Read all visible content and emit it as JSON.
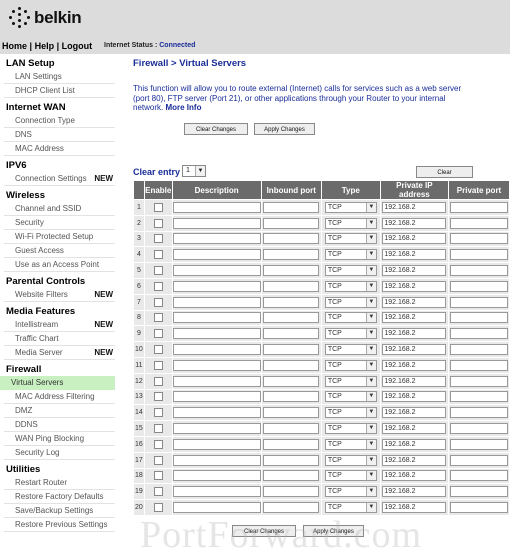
{
  "brand": {
    "logo_text": "belkin"
  },
  "top_nav": {
    "home": "Home",
    "help": "Help",
    "logout": "Logout",
    "sep": "|"
  },
  "status": {
    "label": "Internet Status :",
    "value": "Connected"
  },
  "sidebar": {
    "sections": [
      {
        "title": "LAN Setup",
        "items": [
          {
            "label": "LAN Settings"
          },
          {
            "label": "DHCP Client List"
          }
        ]
      },
      {
        "title": "Internet WAN",
        "items": [
          {
            "label": "Connection Type"
          },
          {
            "label": "DNS"
          },
          {
            "label": "MAC Address"
          }
        ]
      },
      {
        "title": "IPV6",
        "items": [
          {
            "label": "Connection Settings",
            "badge": "NEW"
          }
        ]
      },
      {
        "title": "Wireless",
        "items": [
          {
            "label": "Channel and SSID"
          },
          {
            "label": "Security"
          },
          {
            "label": "Wi-Fi Protected Setup"
          },
          {
            "label": "Guest Access"
          },
          {
            "label": "Use as an Access Point"
          }
        ]
      },
      {
        "title": "Parental Controls",
        "items": [
          {
            "label": "Website Filters",
            "badge": "NEW"
          }
        ]
      },
      {
        "title": "Media Features",
        "items": [
          {
            "label": "Intellistream",
            "badge": "NEW"
          },
          {
            "label": "Traffic Chart"
          },
          {
            "label": "Media Server",
            "badge": "NEW"
          }
        ]
      },
      {
        "title": "Firewall",
        "items": [
          {
            "label": "Virtual Servers",
            "active": true
          },
          {
            "label": "MAC Address Filtering"
          },
          {
            "label": "DMZ"
          },
          {
            "label": "DDNS"
          },
          {
            "label": "WAN Ping Blocking"
          },
          {
            "label": "Security Log"
          }
        ]
      },
      {
        "title": "Utilities",
        "items": [
          {
            "label": "Restart Router"
          },
          {
            "label": "Restore Factory Defaults"
          },
          {
            "label": "Save/Backup Settings"
          },
          {
            "label": "Restore Previous Settings"
          }
        ]
      }
    ]
  },
  "main": {
    "title": "Firewall > Virtual Servers",
    "description": "This function will allow you to route external (Internet) calls for services such as a web server (port 80), FTP server (Port 21), or other applications through your Router to your internal network.",
    "more_info": "More Info",
    "clear_changes": "Clear Changes",
    "apply_changes": "Apply Changes",
    "clear_entry_label": "Clear entry",
    "clear_entry_value": "1",
    "clear_button": "Clear",
    "table": {
      "headers": [
        "",
        "Enable",
        "Description",
        "Inbound port",
        "Type",
        "Private IP address",
        "Private port"
      ],
      "protocol": "TCP",
      "ip_prefix": "192.168.2",
      "rows": [
        "1",
        "2",
        "3",
        "4",
        "5",
        "6",
        "7",
        "8",
        "9",
        "10",
        "11",
        "12",
        "13",
        "14",
        "15",
        "16",
        "17",
        "18",
        "19",
        "20"
      ]
    }
  },
  "watermark": "PortForward.com"
}
